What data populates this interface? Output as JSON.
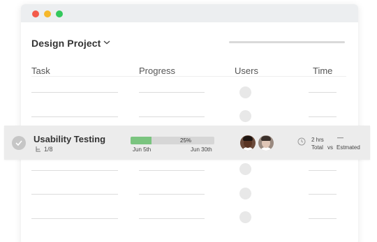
{
  "project": {
    "title": "Design Project"
  },
  "columns": {
    "task": "Task",
    "progress": "Progress",
    "users": "Users",
    "time": "Time"
  },
  "highlighted_task": {
    "name": "Usability Testing",
    "subtasks": "1/8",
    "progress_percent": 25,
    "progress_label": "25%",
    "start_date": "Jun 5th",
    "end_date": "Jun 30th",
    "time_total": "2 hrs",
    "time_estimated": "—",
    "label_total": "Total",
    "label_vs": "vs",
    "label_estimated": "Estmated"
  },
  "colors": {
    "progress_fill": "#7ac47f",
    "row_highlight": "#ececec",
    "window_close": "#f35a4a",
    "window_minimize": "#f6b82b",
    "window_maximize": "#33c85c"
  }
}
